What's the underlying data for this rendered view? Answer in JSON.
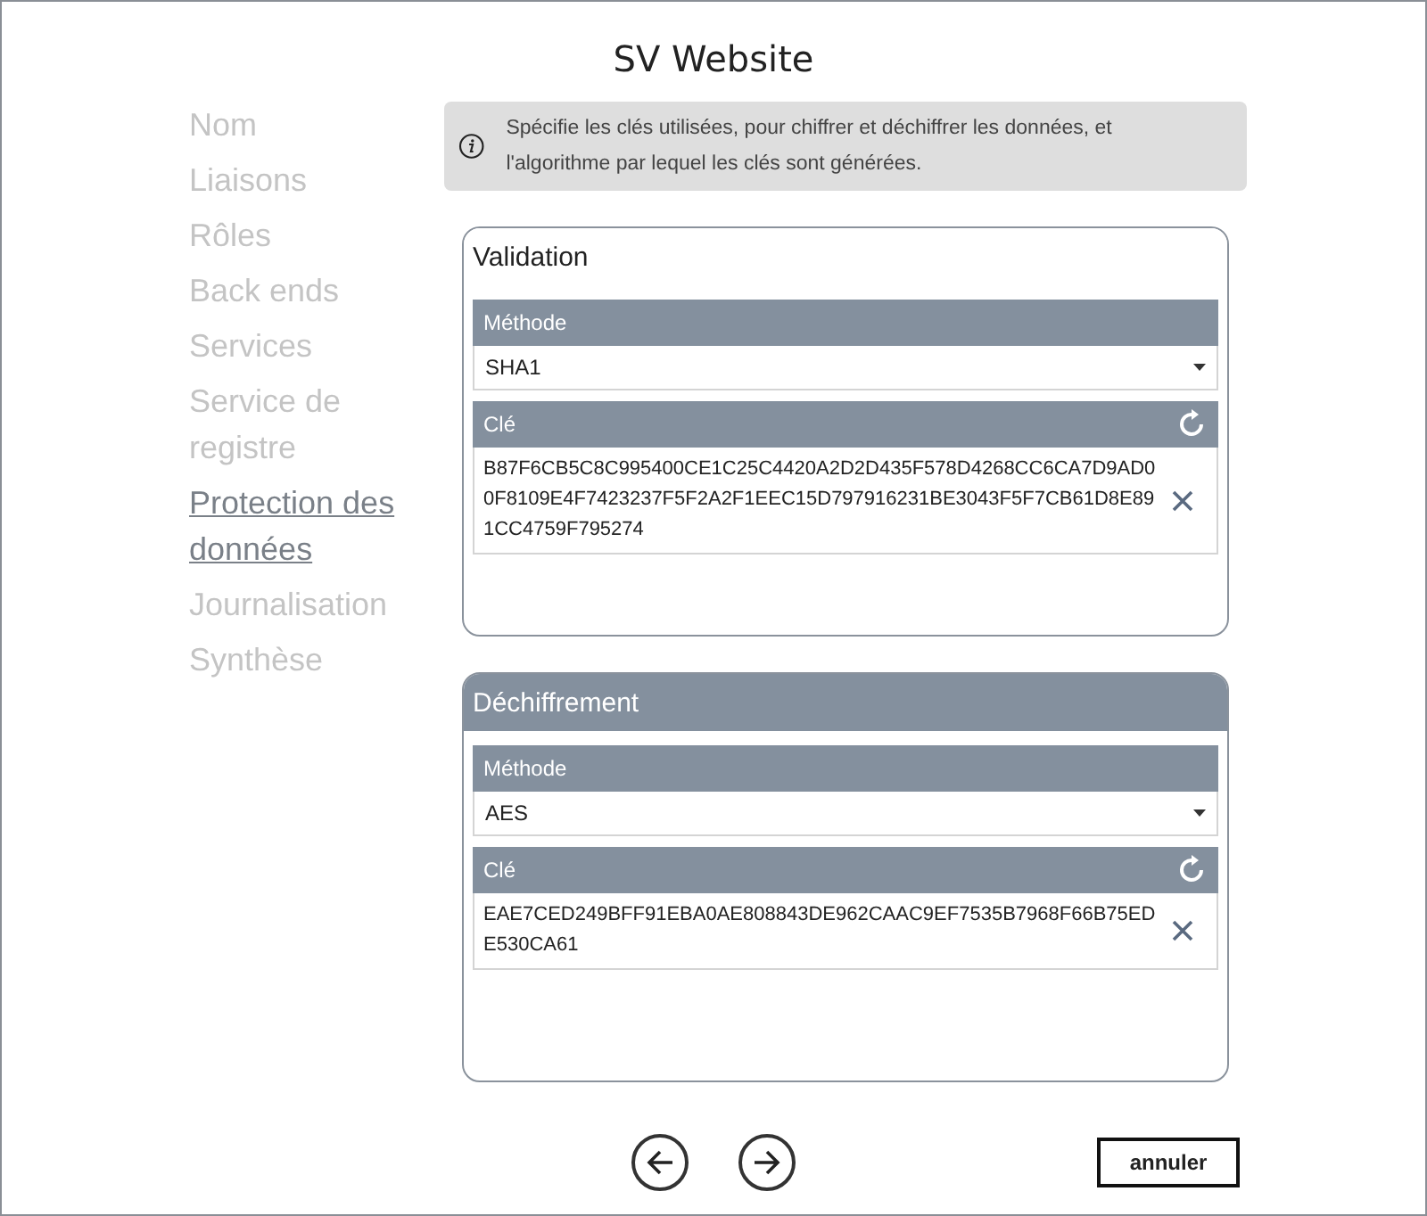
{
  "window": {
    "title": "SV Website"
  },
  "nav": [
    {
      "label": "Nom",
      "selected": false
    },
    {
      "label": "Liaisons",
      "selected": false
    },
    {
      "label": "Rôles",
      "selected": false
    },
    {
      "label": "Back ends",
      "selected": false
    },
    {
      "label": "Services",
      "selected": false
    },
    {
      "label": "Service de registre",
      "selected": false
    },
    {
      "label": "Protection des données",
      "selected": true
    },
    {
      "label": "Journalisation",
      "selected": false
    },
    {
      "label": "Synthèse",
      "selected": false
    }
  ],
  "info": "Spécifie les clés utilisées, pour chiffrer et déchiffrer les données, et l'algorithme par lequel les clés sont générées.",
  "sections": [
    {
      "title": "Validation",
      "selected": false,
      "method_label": "Méthode",
      "method": "SHA1",
      "key_label": "Clé",
      "key": "B87F6CB5C8C995400CE1C25C4420A2D2D435F578D4268CC6CA7D9AD00F8109E4F7423237F5F2A2F1EEC15D797916231BE3043F5F7CB61D8E891CC4759F795274"
    },
    {
      "title": "Déchiffrement",
      "selected": true,
      "method_label": "Méthode",
      "method": "AES",
      "key_label": "Clé",
      "key": "EAE7CED249BFF91EBA0AE808843DE962CAAC9EF7535B7968F66B75EDE530CA61"
    }
  ],
  "footer": {
    "cancel": "annuler"
  }
}
